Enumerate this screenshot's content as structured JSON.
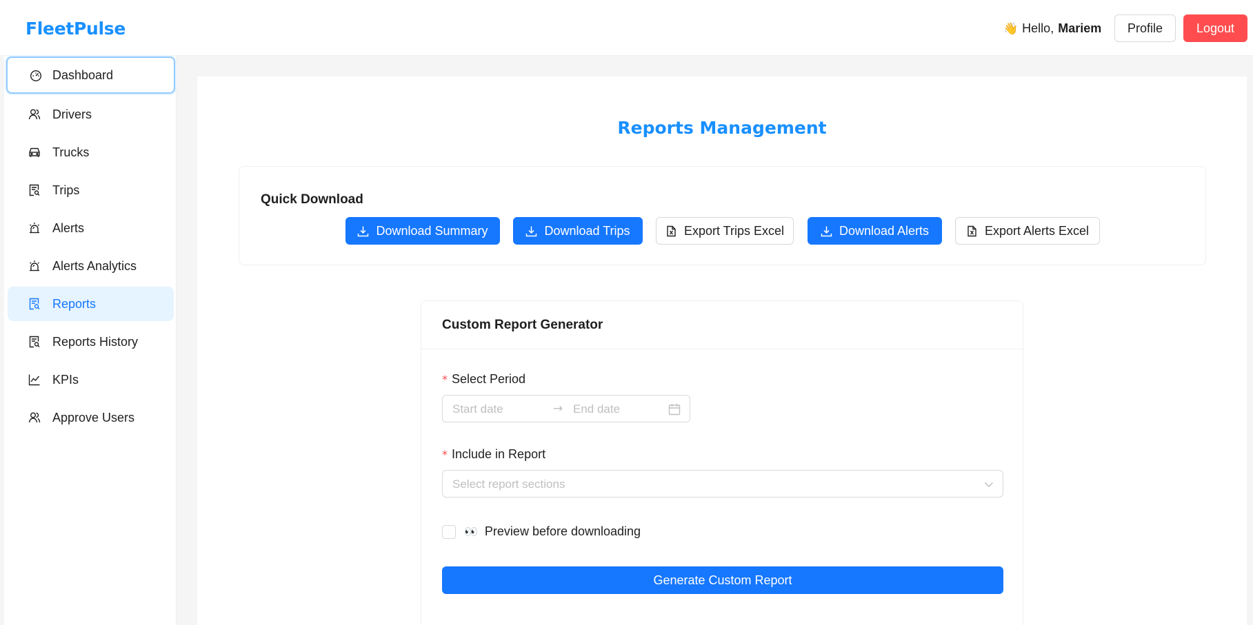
{
  "header": {
    "brand": "FleetPulse",
    "greeting_emoji": "👋",
    "greeting_prefix": "Hello,",
    "username": "Mariem",
    "profile_label": "Profile",
    "logout_label": "Logout"
  },
  "sidebar": {
    "items": [
      {
        "label": "Dashboard",
        "icon": "dashboard-icon",
        "state": "focused"
      },
      {
        "label": "Drivers",
        "icon": "users-icon"
      },
      {
        "label": "Trucks",
        "icon": "car-icon"
      },
      {
        "label": "Trips",
        "icon": "file-search-icon"
      },
      {
        "label": "Alerts",
        "icon": "alert-icon"
      },
      {
        "label": "Alerts Analytics",
        "icon": "alert-icon"
      },
      {
        "label": "Reports",
        "icon": "file-search-icon",
        "state": "active"
      },
      {
        "label": "Reports History",
        "icon": "file-search-icon"
      },
      {
        "label": "KPIs",
        "icon": "line-chart-icon"
      },
      {
        "label": "Approve Users",
        "icon": "users-icon"
      }
    ]
  },
  "main": {
    "title": "Reports Management",
    "quick_download": {
      "title": "Quick Download",
      "buttons": [
        {
          "label": "Download Summary",
          "style": "primary",
          "icon": "download-icon"
        },
        {
          "label": "Download Trips",
          "style": "primary",
          "icon": "download-icon"
        },
        {
          "label": "Export Trips Excel",
          "style": "default",
          "icon": "file-excel-icon"
        },
        {
          "label": "Download Alerts",
          "style": "primary",
          "icon": "download-icon"
        },
        {
          "label": "Export Alerts Excel",
          "style": "default",
          "icon": "file-excel-icon"
        }
      ]
    },
    "custom_report": {
      "title": "Custom Report Generator",
      "period_label": "Select Period",
      "start_placeholder": "Start date",
      "end_placeholder": "End date",
      "include_label": "Include in Report",
      "include_placeholder": "Select report sections",
      "preview_emoji": "👀",
      "preview_label": "Preview before downloading",
      "preview_checked": false,
      "generate_label": "Generate Custom Report"
    }
  },
  "colors": {
    "brand": "#1890ff",
    "primary": "#1677ff",
    "danger": "#ff4d4f",
    "active_bg": "#e6f4ff"
  }
}
